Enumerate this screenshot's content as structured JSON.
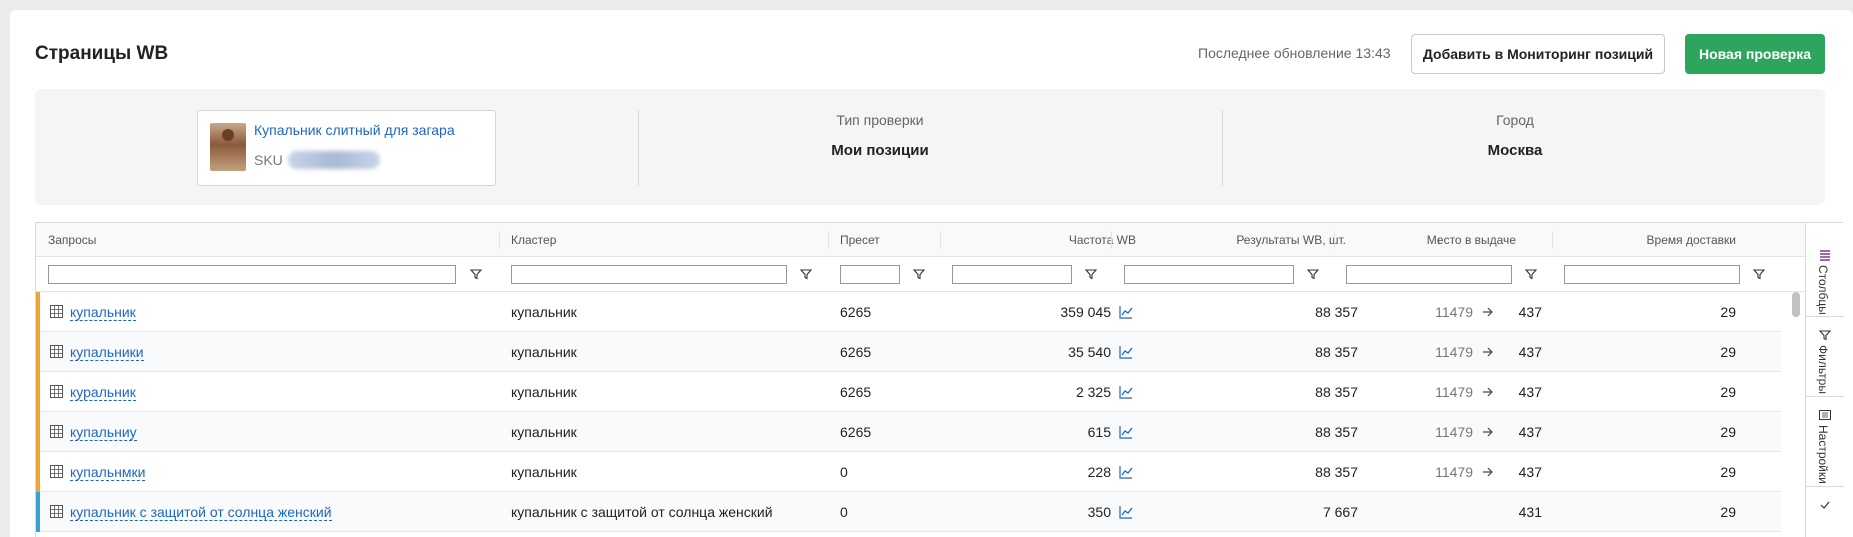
{
  "header": {
    "title": "Страницы WB",
    "last_update": "Последнее обновление 13:43",
    "add_monitoring_label": "Добавить в Мониторинг позиций",
    "new_check_label": "Новая проверка"
  },
  "info": {
    "product_name": "Купальник слитный для загара",
    "sku_label": "SKU",
    "check_type_label": "Тип проверки",
    "check_type_value": "Мои позиции",
    "city_label": "Город",
    "city_value": "Москва"
  },
  "table": {
    "columns": [
      "Запросы",
      "Кластер",
      "Пресет",
      "Частота WB",
      "Результаты WB, шт.",
      "Место в выдаче",
      "Время доставки"
    ],
    "sort_indicator": "↓",
    "rows": [
      {
        "query": "купальник",
        "cluster": "купальник",
        "preset": "6265",
        "freq": "359 045",
        "results": "88 357",
        "pos_from": "11479",
        "pos_to": "437",
        "delivery": "29",
        "bar": "#f0a23b"
      },
      {
        "query": "купальники",
        "cluster": "купальник",
        "preset": "6265",
        "freq": "35 540",
        "results": "88 357",
        "pos_from": "11479",
        "pos_to": "437",
        "delivery": "29",
        "bar": "#f0a23b"
      },
      {
        "query": "куральник",
        "cluster": "купальник",
        "preset": "6265",
        "freq": "2 325",
        "results": "88 357",
        "pos_from": "11479",
        "pos_to": "437",
        "delivery": "29",
        "bar": "#f0a23b"
      },
      {
        "query": "купальниу",
        "cluster": "купальник",
        "preset": "6265",
        "freq": "615",
        "results": "88 357",
        "pos_from": "11479",
        "pos_to": "437",
        "delivery": "29",
        "bar": "#f0a23b"
      },
      {
        "query": "купальнмки",
        "cluster": "купальник",
        "preset": "0",
        "freq": "228",
        "results": "88 357",
        "pos_from": "11479",
        "pos_to": "437",
        "delivery": "29",
        "bar": "#f0a23b"
      },
      {
        "query": "купальник с защитой от солнца женский",
        "cluster": "купальник с защитой от солнца женский",
        "preset": "0",
        "freq": "350",
        "results": "7 667",
        "pos_from": "",
        "pos_to": "431",
        "delivery": "29",
        "bar": "#3aa0d8"
      }
    ]
  },
  "sidebar": {
    "tabs": [
      {
        "label": "Столбцы",
        "icon": "columns-icon"
      },
      {
        "label": "Фильтры",
        "icon": "filter-icon"
      },
      {
        "label": "Настройки",
        "icon": "settings-icon"
      },
      {
        "label": "",
        "icon": "check-icon"
      }
    ]
  },
  "colors": {
    "accent_green": "#2ea55c",
    "link_blue": "#1e66c4",
    "bar_orange": "#f0a23b",
    "bar_blue": "#3aa0d8"
  }
}
